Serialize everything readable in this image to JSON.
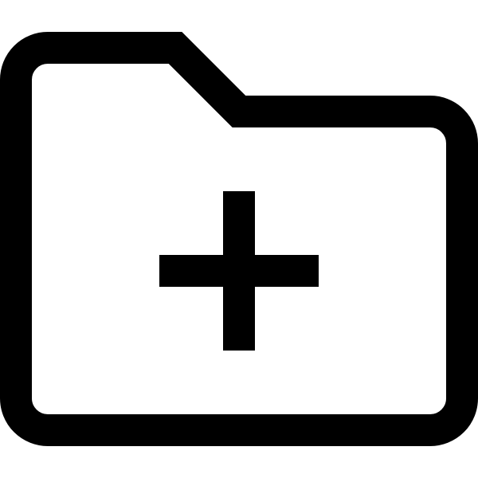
{
  "icon": {
    "name": "folder-plus-icon",
    "stroke_color": "#000000",
    "fill_color": "#ffffff",
    "background_color": "#ffffff"
  }
}
